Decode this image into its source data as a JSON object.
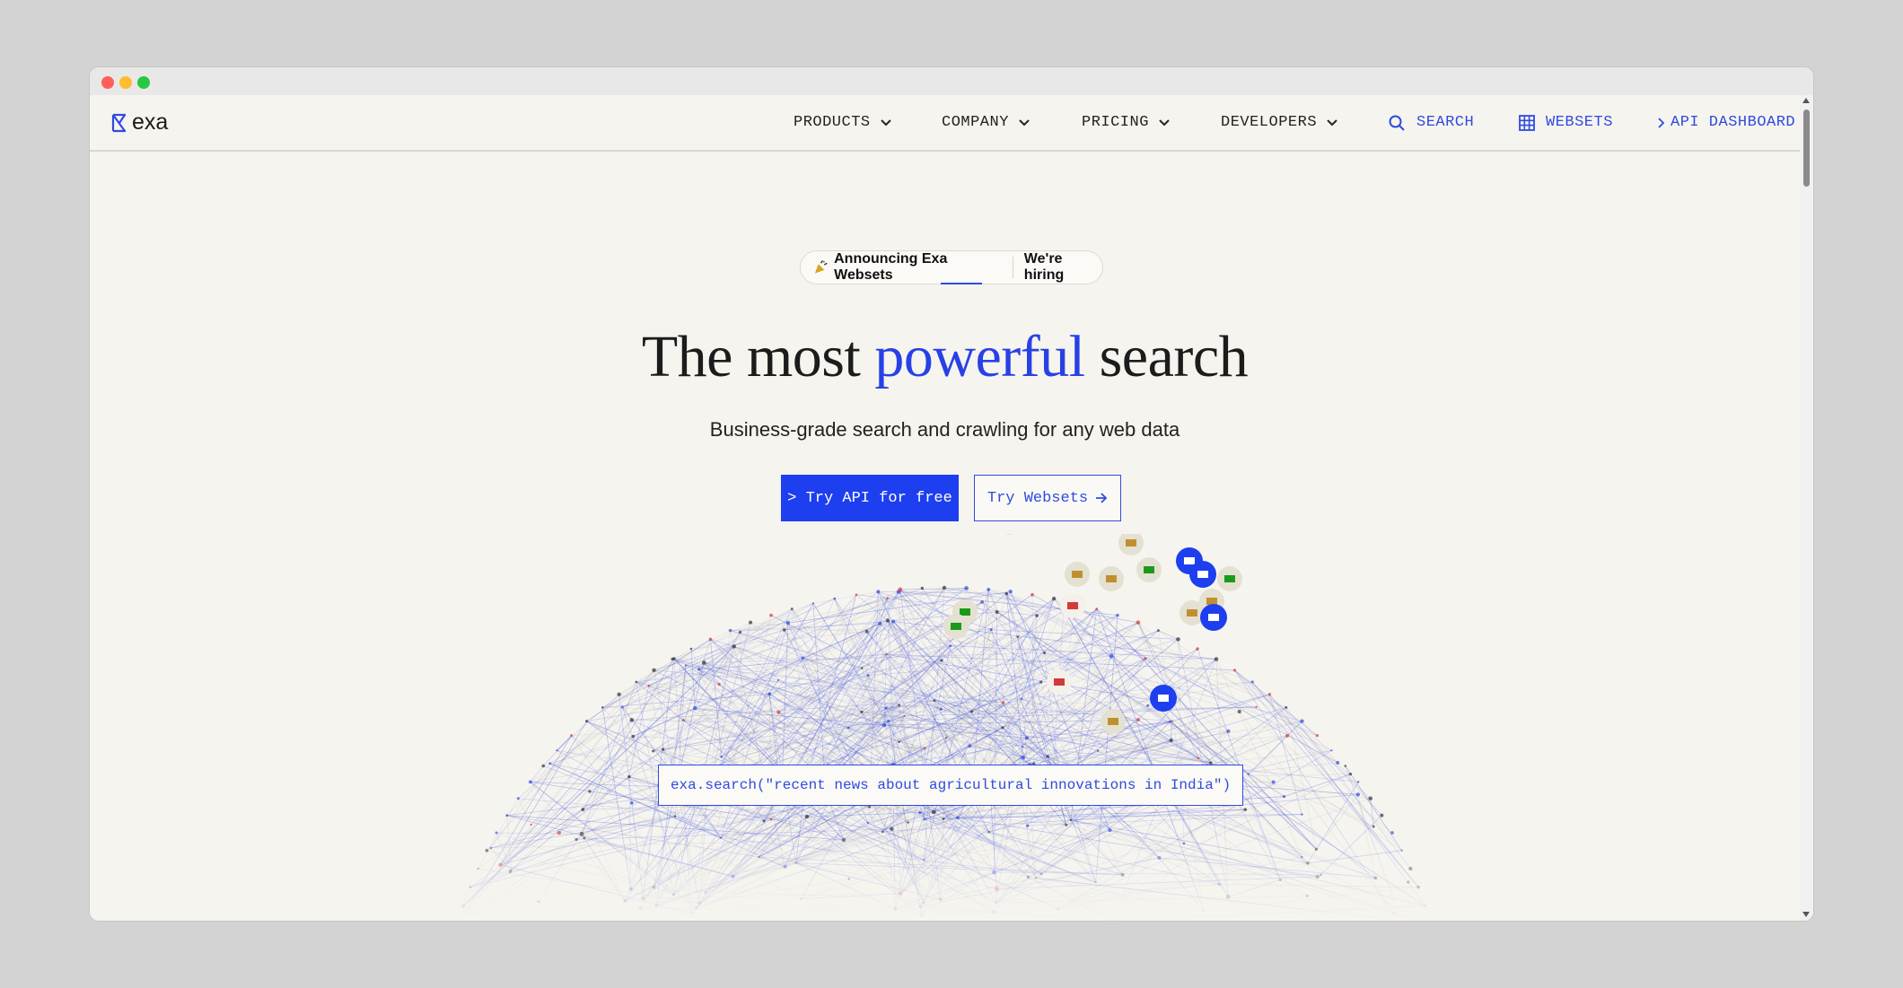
{
  "logo": {
    "text": "exa"
  },
  "nav": {
    "products": "PRODUCTS",
    "company": "COMPANY",
    "pricing": "PRICING",
    "developers": "DEVELOPERS",
    "search": "SEARCH",
    "websets": "WEBSETS",
    "api_dashboard": "API DASHBOARD"
  },
  "badge": {
    "announce": "Announcing Exa Websets",
    "hiring": "We're hiring"
  },
  "hero": {
    "title_before": "The most ",
    "title_accent": "powerful",
    "title_after": " search",
    "subtitle": "Business-grade search and crawling for any web data"
  },
  "cta": {
    "primary": "> Try API for free",
    "secondary": "Try Websets"
  },
  "search_example": "exa.search(\"recent news about agricultural innovations in India\")",
  "colors": {
    "accent": "#1d3ff0",
    "background": "#f6f4ee"
  },
  "icons": {
    "logo": "exa-logo-icon",
    "search": "search-icon",
    "websets": "grid-icon",
    "api": "chevron-right-icon",
    "dropdown": "chevron-down-icon"
  }
}
